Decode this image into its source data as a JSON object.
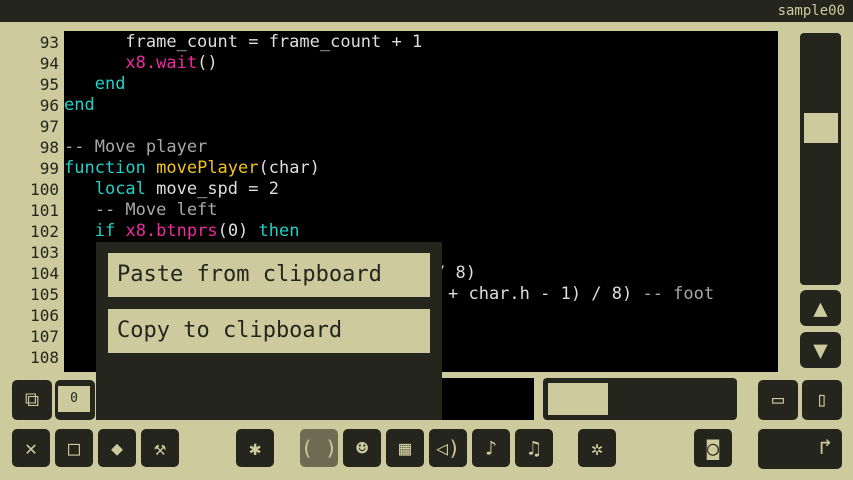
{
  "window": {
    "title": "sample00"
  },
  "editor": {
    "line_numbers": [
      "93",
      "94",
      "95",
      "96",
      "97",
      "98",
      "99",
      "100",
      "101",
      "102",
      "103",
      "104",
      "105",
      "106",
      "107",
      "108"
    ]
  },
  "counter": {
    "value": "0"
  },
  "context_menu": {
    "paste_label": "Paste from clipboard",
    "copy_label": "Copy to clipboard"
  },
  "code_texts": {
    "l93": "      frame_count = frame_count + 1",
    "l94a": "      ",
    "l94b": "x8.wait",
    "l94c": "()",
    "l95a": "   ",
    "l95b": "end",
    "l96": "end",
    "l98": "-- Move player",
    "l99a": "function",
    "l99b": " ",
    "l99c": "movePlayer",
    "l99d": "(char)",
    "l100a": "   ",
    "l100b": "local",
    "l100c": " move_spd = 2",
    "l101": "   -- Move left",
    "l102a": "   ",
    "l102b": "if",
    "l102c": " ",
    "l102d": "x8.btnprs",
    "l102e": "(0) ",
    "l102f": "then",
    "l104": "/ 8)",
    "l105a": "+ char.h - 1) / 8) ",
    "l105b": "-- foot"
  },
  "icons": {
    "copy": "copy-icon",
    "zoom": "zoom-icon",
    "save": "save-icon",
    "close": "close-icon",
    "new": "new-file-icon",
    "eraser": "eraser-icon",
    "wrench": "wrench-icon",
    "bug": "bug-icon",
    "code": "code-icon",
    "sprite": "sprite-icon",
    "map": "map-icon",
    "sound": "sound-icon",
    "note": "note-icon",
    "music": "music-icon",
    "run-man": "run-icon",
    "screen": "screenshot-icon",
    "export": "export-icon",
    "up": "up-arrow-icon",
    "down": "down-arrow-icon"
  },
  "colors": {
    "background": "#cdcb9d",
    "dark": "#24261d",
    "keyword": "#1fd2c8",
    "function": "#f2c51c",
    "api": "#ee2ba0",
    "comment": "#a8a8a8"
  }
}
